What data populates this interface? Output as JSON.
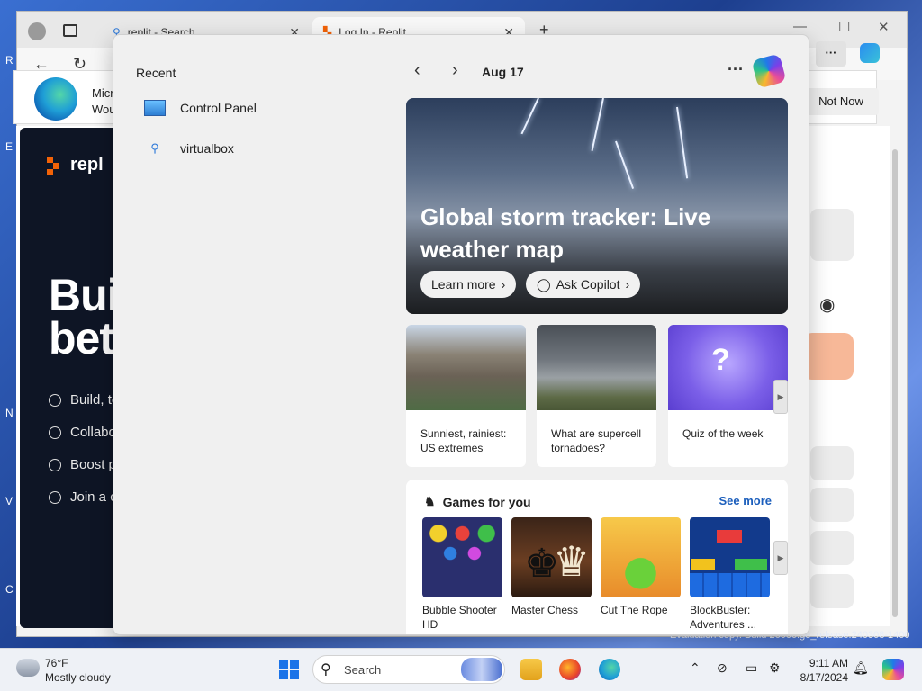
{
  "desktop": {
    "edge_letters": [
      "R",
      "E",
      "N",
      "V",
      "C"
    ],
    "evaluation_text": "Evaluation copy. Build 26000.ge_release.240308-1400"
  },
  "browser": {
    "tabs": [
      {
        "label": "replit - Search",
        "icon": "search-icon"
      },
      {
        "label": "Log In - Replit",
        "icon": "replit-icon"
      }
    ],
    "new_tab": "+",
    "infobar": {
      "title_partial": "Micr",
      "subtitle_partial": "Wou",
      "not_now": "Not Now"
    }
  },
  "replit_page": {
    "logo_text": "repl",
    "headline_line1": "Bui",
    "headline_line2": "bet",
    "features": [
      "Build, te",
      "Collabo",
      "Boost p",
      "Join a c"
    ]
  },
  "widgets": {
    "recent_title": "Recent",
    "recent_items": [
      {
        "label": "Control Panel",
        "icon": "control-panel-icon"
      },
      {
        "label": "virtualbox",
        "icon": "search-icon"
      }
    ],
    "date": "Aug 17",
    "more": "···",
    "hero": {
      "title": "Global storm tracker: Live weather map",
      "learn_more": "Learn more",
      "ask_copilot": "Ask Copilot"
    },
    "cards": [
      {
        "caption": "Sunniest, rainiest: US extremes"
      },
      {
        "caption": "What are supercell tornadoes?"
      },
      {
        "caption": "Quiz of the week"
      }
    ],
    "games": {
      "title": "Games for you",
      "see_more": "See more",
      "items": [
        {
          "label": "Bubble Shooter HD"
        },
        {
          "label": "Master Chess"
        },
        {
          "label": "Cut The Rope"
        },
        {
          "label": "BlockBuster: Adventures ..."
        }
      ]
    }
  },
  "taskbar": {
    "weather_temp": "76°F",
    "weather_desc": "Mostly cloudy",
    "search_label": "Search",
    "time": "9:11 AM",
    "date": "8/17/2024"
  }
}
